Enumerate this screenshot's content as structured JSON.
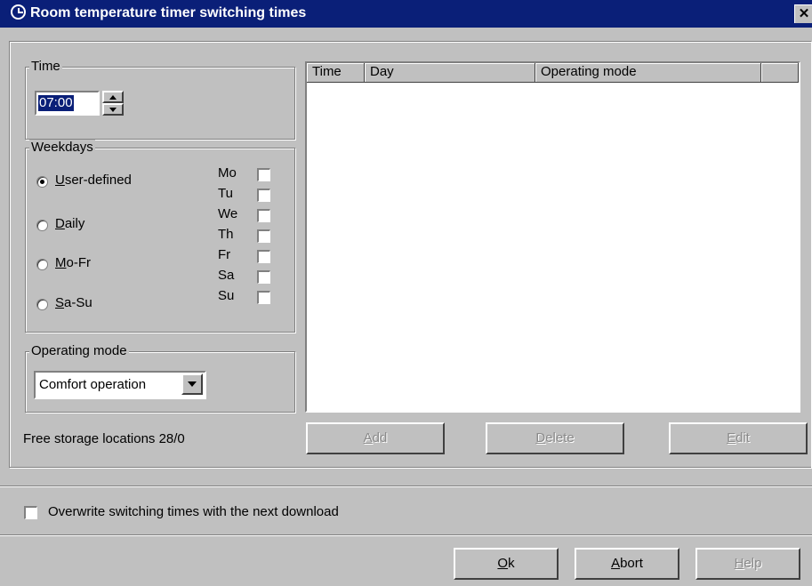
{
  "window": {
    "title": "Room temperature timer switching times",
    "close_label": "✕"
  },
  "time_group": {
    "legend": "Time",
    "value": "07:00"
  },
  "weekdays_group": {
    "legend": "Weekdays",
    "options": [
      {
        "accel": "U",
        "rest": "ser-defined",
        "selected": true
      },
      {
        "accel": "D",
        "rest": "aily",
        "selected": false
      },
      {
        "accel": "M",
        "rest": "o-Fr",
        "selected": false
      },
      {
        "accel": "S",
        "rest": "a-Su",
        "selected": false
      }
    ],
    "days": [
      "Mo",
      "Tu",
      "We",
      "Th",
      "Fr",
      "Sa",
      "Su"
    ]
  },
  "operating_mode_group": {
    "legend": "Operating mode",
    "selected": "Comfort operation"
  },
  "table": {
    "columns": [
      "Time",
      "Day",
      "Operating mode",
      ""
    ]
  },
  "storage_text": "Free storage locations 28/0",
  "actions": {
    "add": {
      "accel": "A",
      "rest": "dd"
    },
    "delete": {
      "accel": "D",
      "rest": "elete"
    },
    "edit": {
      "accel": "E",
      "rest": "dit"
    }
  },
  "overwrite_label": "Overwrite switching times with the next download",
  "footer": {
    "ok": {
      "accel": "O",
      "rest": "k"
    },
    "abort": {
      "accel": "A",
      "rest": "bort"
    },
    "help": {
      "accel": "H",
      "rest": "elp"
    }
  }
}
